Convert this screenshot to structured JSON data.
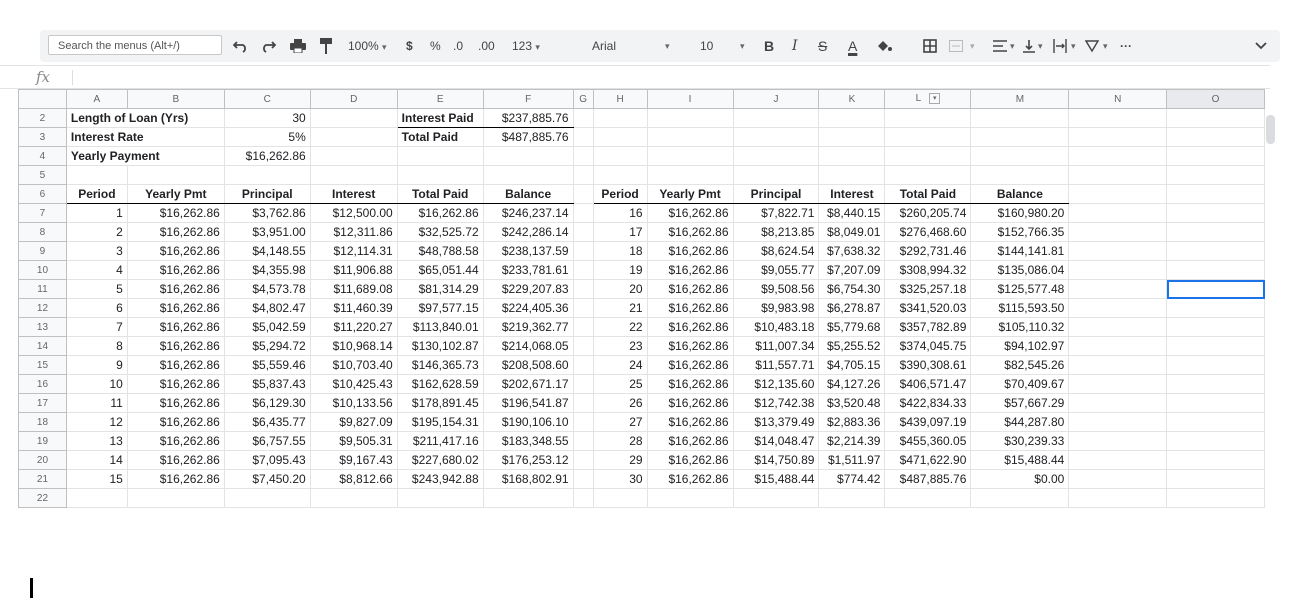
{
  "toolbar": {
    "search_placeholder": "Search the menus (Alt+/)",
    "zoom": "100%",
    "currency": "$",
    "percent": "%",
    "dec_decrease": ".0",
    "dec_increase": ".00",
    "format_more": "123",
    "font": "Arial",
    "font_size": "10",
    "bold": "B",
    "italic": "I",
    "strike": "S",
    "text_color": "A",
    "more": "···"
  },
  "formula_bar": {
    "fx": "fx"
  },
  "columns": [
    "A",
    "B",
    "C",
    "D",
    "E",
    "F",
    "G",
    "H",
    "I",
    "J",
    "K",
    "L",
    "M",
    "N",
    "O"
  ],
  "summary": {
    "loan_label": "Length of Loan (Yrs)",
    "loan_value": "30",
    "rate_label": "Interest Rate",
    "rate_value": "5%",
    "payment_label": "Yearly Payment",
    "payment_value": "$16,262.86",
    "interest_paid_label": "Interest Paid",
    "interest_paid_value": "$237,885.76",
    "total_paid_label": "Total Paid",
    "total_paid_value": "$487,885.76"
  },
  "headers": [
    "Period",
    "Yearly Pmt",
    "Principal",
    "Interest",
    "Total Paid",
    "Balance"
  ],
  "left_rows": [
    [
      "1",
      "$16,262.86",
      "$3,762.86",
      "$12,500.00",
      "$16,262.86",
      "$246,237.14"
    ],
    [
      "2",
      "$16,262.86",
      "$3,951.00",
      "$12,311.86",
      "$32,525.72",
      "$242,286.14"
    ],
    [
      "3",
      "$16,262.86",
      "$4,148.55",
      "$12,114.31",
      "$48,788.58",
      "$238,137.59"
    ],
    [
      "4",
      "$16,262.86",
      "$4,355.98",
      "$11,906.88",
      "$65,051.44",
      "$233,781.61"
    ],
    [
      "5",
      "$16,262.86",
      "$4,573.78",
      "$11,689.08",
      "$81,314.29",
      "$229,207.83"
    ],
    [
      "6",
      "$16,262.86",
      "$4,802.47",
      "$11,460.39",
      "$97,577.15",
      "$224,405.36"
    ],
    [
      "7",
      "$16,262.86",
      "$5,042.59",
      "$11,220.27",
      "$113,840.01",
      "$219,362.77"
    ],
    [
      "8",
      "$16,262.86",
      "$5,294.72",
      "$10,968.14",
      "$130,102.87",
      "$214,068.05"
    ],
    [
      "9",
      "$16,262.86",
      "$5,559.46",
      "$10,703.40",
      "$146,365.73",
      "$208,508.60"
    ],
    [
      "10",
      "$16,262.86",
      "$5,837.43",
      "$10,425.43",
      "$162,628.59",
      "$202,671.17"
    ],
    [
      "11",
      "$16,262.86",
      "$6,129.30",
      "$10,133.56",
      "$178,891.45",
      "$196,541.87"
    ],
    [
      "12",
      "$16,262.86",
      "$6,435.77",
      "$9,827.09",
      "$195,154.31",
      "$190,106.10"
    ],
    [
      "13",
      "$16,262.86",
      "$6,757.55",
      "$9,505.31",
      "$211,417.16",
      "$183,348.55"
    ],
    [
      "14",
      "$16,262.86",
      "$7,095.43",
      "$9,167.43",
      "$227,680.02",
      "$176,253.12"
    ],
    [
      "15",
      "$16,262.86",
      "$7,450.20",
      "$8,812.66",
      "$243,942.88",
      "$168,802.91"
    ]
  ],
  "right_rows": [
    [
      "16",
      "$16,262.86",
      "$7,822.71",
      "$8,440.15",
      "$260,205.74",
      "$160,980.20"
    ],
    [
      "17",
      "$16,262.86",
      "$8,213.85",
      "$8,049.01",
      "$276,468.60",
      "$152,766.35"
    ],
    [
      "18",
      "$16,262.86",
      "$8,624.54",
      "$7,638.32",
      "$292,731.46",
      "$144,141.81"
    ],
    [
      "19",
      "$16,262.86",
      "$9,055.77",
      "$7,207.09",
      "$308,994.32",
      "$135,086.04"
    ],
    [
      "20",
      "$16,262.86",
      "$9,508.56",
      "$6,754.30",
      "$325,257.18",
      "$125,577.48"
    ],
    [
      "21",
      "$16,262.86",
      "$9,983.98",
      "$6,278.87",
      "$341,520.03",
      "$115,593.50"
    ],
    [
      "22",
      "$16,262.86",
      "$10,483.18",
      "$5,779.68",
      "$357,782.89",
      "$105,110.32"
    ],
    [
      "23",
      "$16,262.86",
      "$11,007.34",
      "$5,255.52",
      "$374,045.75",
      "$94,102.97"
    ],
    [
      "24",
      "$16,262.86",
      "$11,557.71",
      "$4,705.15",
      "$390,308.61",
      "$82,545.26"
    ],
    [
      "25",
      "$16,262.86",
      "$12,135.60",
      "$4,127.26",
      "$406,571.47",
      "$70,409.67"
    ],
    [
      "26",
      "$16,262.86",
      "$12,742.38",
      "$3,520.48",
      "$422,834.33",
      "$57,667.29"
    ],
    [
      "27",
      "$16,262.86",
      "$13,379.49",
      "$2,883.36",
      "$439,097.19",
      "$44,287.80"
    ],
    [
      "28",
      "$16,262.86",
      "$14,048.47",
      "$2,214.39",
      "$455,360.05",
      "$30,239.33"
    ],
    [
      "29",
      "$16,262.86",
      "$14,750.89",
      "$1,511.97",
      "$471,622.90",
      "$15,488.44"
    ],
    [
      "30",
      "$16,262.86",
      "$15,488.44",
      "$774.42",
      "$487,885.76",
      "$0.00"
    ]
  ],
  "row_numbers": [
    "2",
    "3",
    "4",
    "5",
    "6",
    "7",
    "8",
    "9",
    "10",
    "11",
    "12",
    "13",
    "14",
    "15",
    "16",
    "17",
    "18",
    "19",
    "20",
    "21",
    "22"
  ]
}
